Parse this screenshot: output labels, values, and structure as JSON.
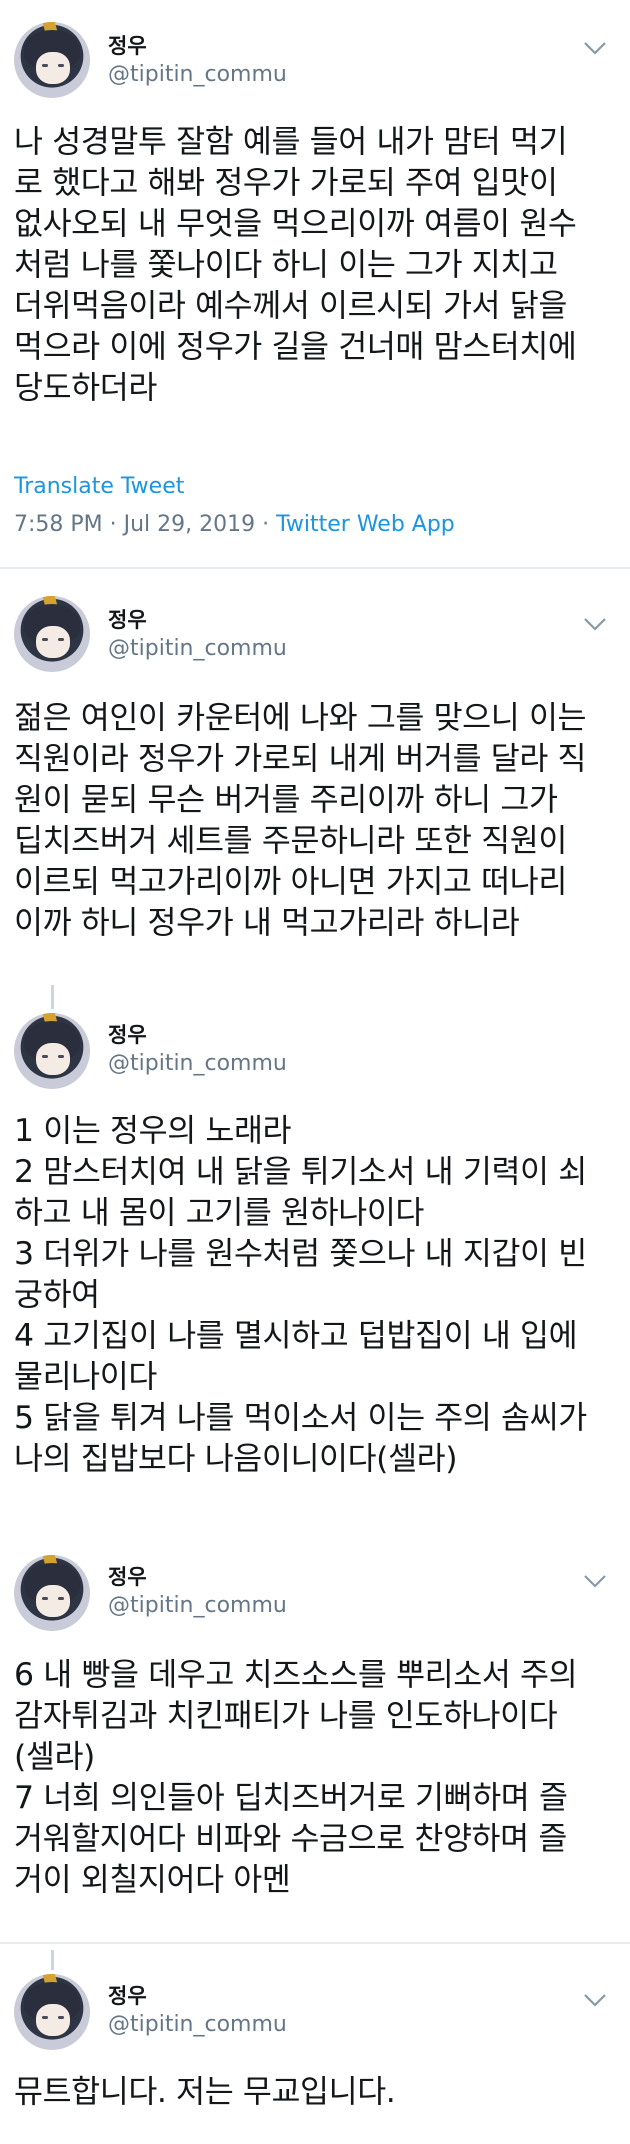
{
  "tweets": [
    {
      "name": "정우",
      "handle": "@tipitin_commu",
      "text": "나 성경말투 잘함 예를 들어 내가 맘터 먹기\n로 했다고 해봐 정우가 가로되 주여 입맛이\n없사오되 내 무엇을 먹으리이까 여름이 원수\n처럼 나를 쫓나이다 하니 이는 그가 지치고\n더위먹음이라 예수께서 이르시되 가서 닭을\n먹으라 이에 정우가 길을 건너매 맘스터치에\n당도하더라",
      "translate": "Translate Tweet",
      "time": "7:58 PM · Jul 29, 2019 · ",
      "source": "Twitter Web App"
    },
    {
      "name": "정우",
      "handle": "@tipitin_commu",
      "text": "젊은 여인이 카운터에 나와 그를 맞으니 이는\n직원이라 정우가 가로되 내게 버거를 달라 직\n원이 묻되 무슨 버거를 주리이까 하니 그가\n딥치즈버거 세트를 주문하니라 또한 직원이\n이르되 먹고가리이까 아니면 가지고 떠나리\n이까 하니 정우가 내 먹고가리라 하니라"
    },
    {
      "name": "정우",
      "handle": "@tipitin_commu",
      "text": "1 이는 정우의 노래라\n2 맘스터치여 내 닭을 튀기소서 내 기력이 쇠\n하고 내 몸이 고기를 원하나이다\n3 더위가 나를 원수처럼 쫓으나 내 지갑이 빈\n궁하여\n4 고기집이 나를 멸시하고 덥밥집이 내 입에\n물리나이다\n5 닭을 튀겨 나를 먹이소서 이는 주의 솜씨가\n나의 집밥보다 나음이니이다(셀라)"
    },
    {
      "name": "정우",
      "handle": "@tipitin_commu",
      "text": "6 내 빵을 데우고 치즈소스를 뿌리소서 주의\n감자튀김과 치킨패티가 나를 인도하나이다\n(셀라)\n7 너희 의인들아 딥치즈버거로 기뻐하며 즐\n거워할지어다 비파와 수금으로 찬양하며 즐\n거이 외칠지어다 아멘"
    },
    {
      "name": "정우",
      "handle": "@tipitin_commu",
      "text": "뮤트합니다. 저는 무교입니다."
    }
  ],
  "colors": {
    "link": "#1b95e0",
    "secondary": "#657786",
    "divider": "#e6ecf0",
    "thread": "#ccd6dd"
  }
}
